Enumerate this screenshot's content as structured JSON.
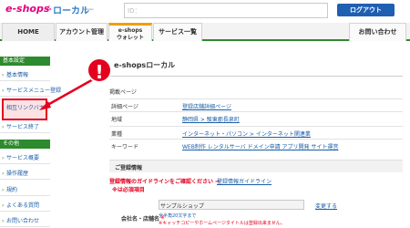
{
  "header": {
    "logo_main": "e-shops",
    "logo_amp": "&",
    "logo_local": "ローカル",
    "logo_sub": "e-shops",
    "id_label": "ID：",
    "logout_label": "ログアウト"
  },
  "nav": {
    "tabs": [
      {
        "label": "HOME"
      },
      {
        "label": "アカウント管理"
      },
      {
        "label": "e-shops\nウォレット"
      },
      {
        "label": "サービス一覧"
      },
      {
        "label": "お問い合わせ"
      }
    ]
  },
  "sidebar": {
    "sections": [
      {
        "title": "基本設定",
        "items": [
          "基本情報",
          "サービスメニュー登録",
          "相互リンクバナー",
          "サービス終了"
        ]
      },
      {
        "title": "その他",
        "items": [
          "サービス概要",
          "操作履歴",
          "規約",
          "よくある質問",
          "お問い合わせ"
        ]
      }
    ]
  },
  "main": {
    "title": "e-shopsローカル",
    "section_title": "掲載ページ",
    "rows": [
      {
        "label": "詳細ページ",
        "value": "登録店舗詳細ページ"
      },
      {
        "label": "地域",
        "value": "静岡県 > 駿東郡長泉町"
      },
      {
        "label": "業種",
        "value": "インターネット・パソコン > インターネット関連業"
      },
      {
        "label": "キーワード",
        "value": "WEB制作  レンタルサーバ  ドメイン申請  アプリ開発  サイト運営"
      }
    ],
    "registration": {
      "title": "ご登録情報",
      "notice": "登録情報のガイドラインをご確認ください ⇒",
      "notice_link": "登録情報ガイドライン",
      "required_note": "※は必須項目",
      "shop_label": "会社名・店舗名",
      "required_mark": "※",
      "shop_value": "サンプルショップ",
      "hint1": "全半角20文字まで",
      "hint2": "※キャッチコピーやホームページタイトルは登録出来ません。",
      "change_label": "変更する"
    }
  },
  "warning_mark": "!",
  "colors": {
    "brand_pink": "#e4007f",
    "brand_blue": "#2e7fc9",
    "accent_green": "#2e8a2e",
    "alert_red": "#e4001f",
    "button_blue": "#1f5fb2"
  }
}
